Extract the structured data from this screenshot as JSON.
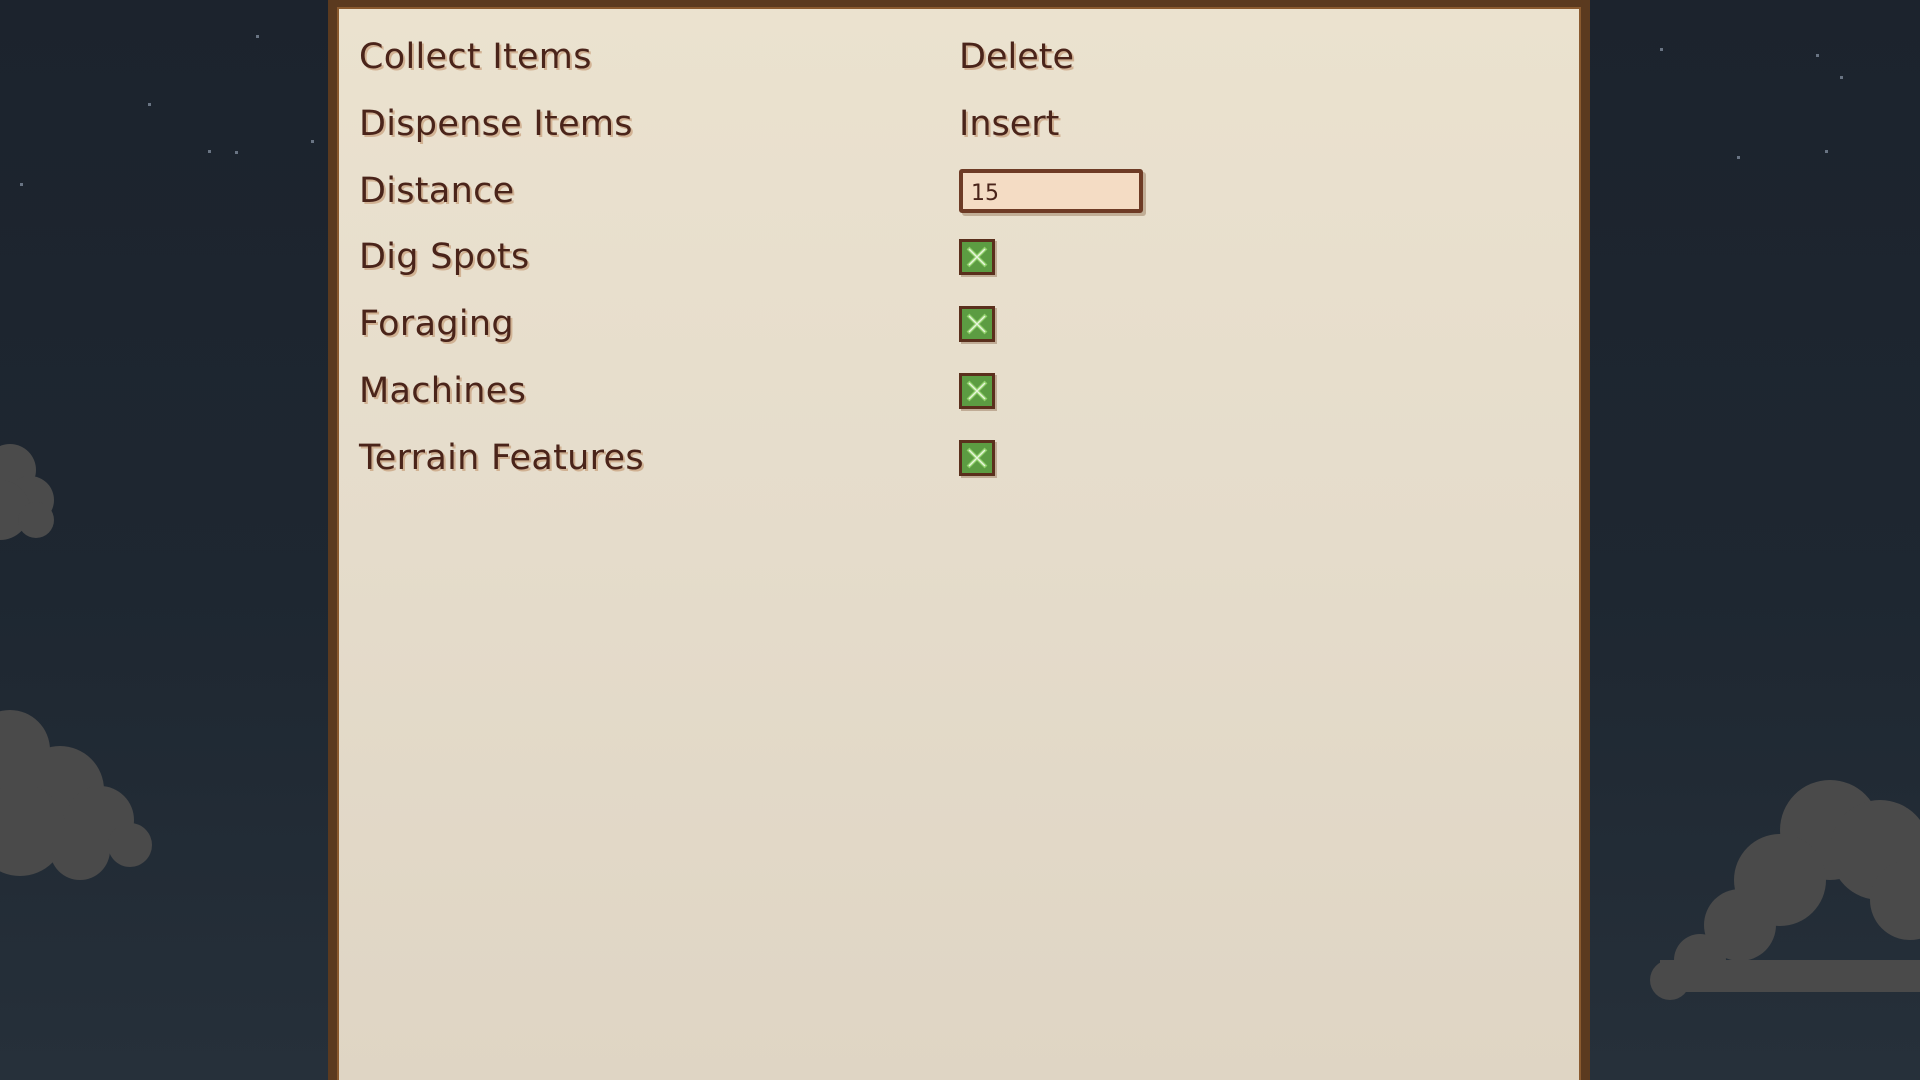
{
  "colors": {
    "panel_background": "#e8dfcc",
    "panel_border": "#5b3a1f",
    "text": "#4a241a",
    "checkbox_fill": "#5c9c42",
    "night_sky": "#1e2731"
  },
  "settings": {
    "rows": [
      {
        "label": "Collect Items",
        "type": "keybind",
        "value": "Delete"
      },
      {
        "label": "Dispense Items",
        "type": "keybind",
        "value": "Insert"
      },
      {
        "label": "Distance",
        "type": "number",
        "value": "15"
      },
      {
        "label": "Dig Spots",
        "type": "checkbox",
        "checked": true,
        "icon": "checkmark-x-icon"
      },
      {
        "label": "Foraging",
        "type": "checkbox",
        "checked": true,
        "icon": "checkmark-x-icon"
      },
      {
        "label": "Machines",
        "type": "checkbox",
        "checked": true,
        "icon": "checkmark-x-icon"
      },
      {
        "label": "Terrain Features",
        "type": "checkbox",
        "checked": true,
        "icon": "checkmark-x-icon"
      }
    ]
  }
}
